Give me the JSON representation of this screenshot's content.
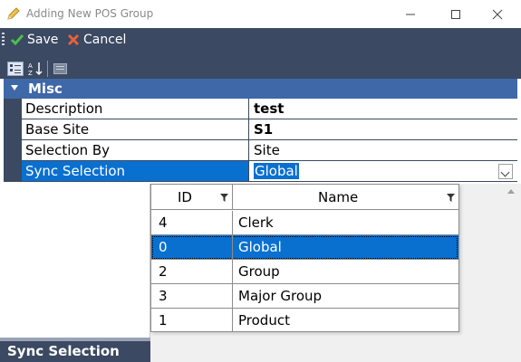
{
  "window": {
    "title": "Adding New POS Group"
  },
  "toolbar": {
    "save_label": "Save",
    "cancel_label": "Cancel"
  },
  "grid": {
    "category": "Misc",
    "rows": [
      {
        "name": "Description",
        "value": "test",
        "bold": true
      },
      {
        "name": "Base Site",
        "value": "S1",
        "bold": true
      },
      {
        "name": "Selection By",
        "value": "Site",
        "bold": false
      },
      {
        "name": "Sync Selection",
        "value": "Global",
        "bold": false,
        "selected": true
      }
    ]
  },
  "dropdown": {
    "columns": [
      "ID",
      "Name"
    ],
    "rows": [
      {
        "id": "4",
        "name": "Clerk"
      },
      {
        "id": "0",
        "name": "Global",
        "selected": true
      },
      {
        "id": "2",
        "name": "Group"
      },
      {
        "id": "3",
        "name": "Major Group"
      },
      {
        "id": "1",
        "name": "Product"
      }
    ]
  },
  "description_panel": {
    "title": "Sync Selection"
  },
  "icons": {
    "title": "pencil-icon",
    "save": "check-icon",
    "cancel": "x-icon",
    "categorized": "categorized-view-icon",
    "alphabetical": "alphabetical-sort-icon",
    "property_pages": "property-pages-icon",
    "filter": "filter-icon"
  },
  "colors": {
    "toolbar_bg": "#3b4962",
    "category_bg": "#3f68a8",
    "selection": "#0a70d0"
  }
}
